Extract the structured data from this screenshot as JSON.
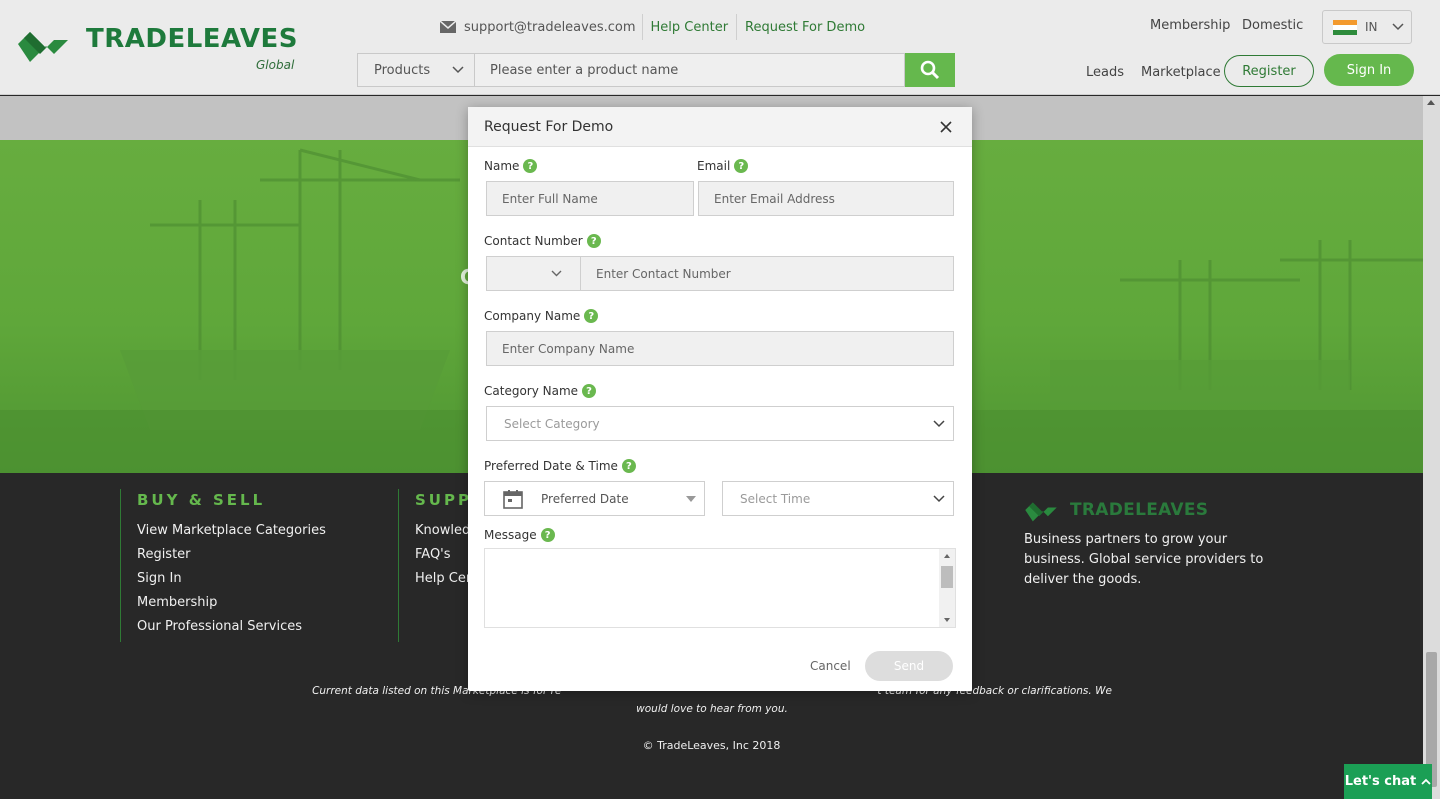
{
  "header": {
    "brand": "TRADELEAVES",
    "brand_sub": "Global",
    "email": "support@tradeleaves.com",
    "help_center": "Help Center",
    "request_demo": "Request For Demo",
    "search": {
      "category": "Products",
      "placeholder": "Please enter a product name"
    },
    "nav": {
      "membership": "Membership",
      "domestic": "Domestic",
      "leads": "Leads",
      "marketplace": "Marketplace"
    },
    "country": "IN",
    "register": "Register",
    "signin": "Sign In"
  },
  "hero": {
    "partial_text": "C"
  },
  "modal": {
    "title": "Request For Demo",
    "fields": {
      "name_label": "Name",
      "name_placeholder": "Enter Full Name",
      "email_label": "Email",
      "email_placeholder": "Enter Email Address",
      "contact_label": "Contact Number",
      "contact_placeholder": "Enter Contact Number",
      "company_label": "Company Name",
      "company_placeholder": "Enter Company Name",
      "category_label": "Category Name",
      "category_placeholder": "Select Category",
      "datetime_label": "Preferred Date & Time",
      "date_placeholder": "Preferred Date",
      "time_placeholder": "Select Time",
      "message_label": "Message"
    },
    "help_glyph": "?",
    "cancel": "Cancel",
    "send": "Send"
  },
  "footer": {
    "buy_sell": {
      "title": "BUY & SELL",
      "links": [
        "View Marketplace Categories",
        "Register",
        "Sign In",
        "Membership",
        "Our Professional Services"
      ]
    },
    "support": {
      "title": "SUPP",
      "links": [
        "Knowled",
        "FAQ's",
        "Help Cen"
      ]
    },
    "brand": "TRADELEAVES",
    "tagline": "Business partners to grow your business. Global service providers to deliver the goods.",
    "note_left": "Current data listed on this Marketplace is for re",
    "note_right": "t team for any feedback or clarifications. We",
    "note_line2": "would love to hear from you.",
    "copyright": "© TradeLeaves, Inc 2018",
    "chat": "Let's chat"
  },
  "colors": {
    "brand_green": "#65b84d",
    "dark_green": "#2f7a35",
    "footer_bg": "#282828"
  }
}
